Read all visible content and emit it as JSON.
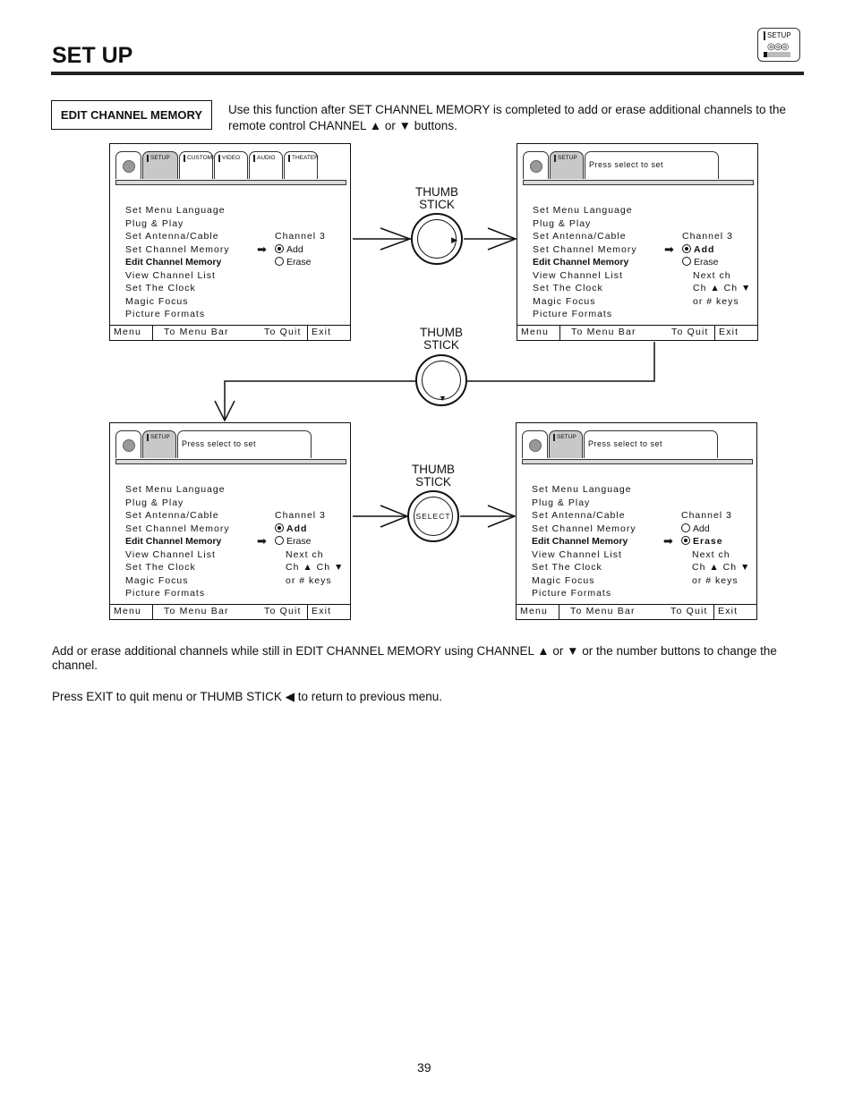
{
  "page": {
    "title": "SET UP",
    "corner_icon_label": "SETUP",
    "page_number": "39"
  },
  "section": {
    "label": "EDIT CHANNEL MEMORY",
    "intro": "Use this function after SET CHANNEL MEMORY is completed to add or erase additional channels to the remote control CHANNEL ▲ or ▼ buttons."
  },
  "menu_tabs": [
    "SETUP",
    "CUSTOMIZE",
    "VIDEO",
    "AUDIO",
    "THEATER"
  ],
  "status_text": "Press select to set",
  "menu_items": [
    "Set Menu Language",
    "Plug & Play",
    "Set Antenna/Cable",
    "Set Channel Memory",
    "Edit Channel Memory",
    "View Channel List",
    "Set The Clock",
    "Magic Focus",
    "Picture Formats"
  ],
  "footer": {
    "menu": "Menu",
    "to_menu_bar": "To Menu Bar",
    "to_quit": "To Quit",
    "exit": "Exit"
  },
  "options": {
    "channel": "Channel 3",
    "add": "Add",
    "erase": "Erase",
    "next_ch": "Next ch",
    "ch_keys": "Ch ▲ Ch ▼",
    "num_keys": "or # keys"
  },
  "screens": [
    {
      "id": 1,
      "add_selected": true,
      "erase_selected": false,
      "pointer_on": "add",
      "bold_option": "none",
      "show_hints": false
    },
    {
      "id": 2,
      "add_selected": true,
      "erase_selected": false,
      "pointer_on": "add",
      "bold_option": "add",
      "show_hints": true
    },
    {
      "id": 3,
      "add_selected": true,
      "erase_selected": false,
      "pointer_on": "erase",
      "bold_option": "add",
      "show_hints": true
    },
    {
      "id": 4,
      "add_selected": false,
      "erase_selected": true,
      "pointer_on": "erase",
      "bold_option": "erase",
      "show_hints": true
    }
  ],
  "thumb_stick": {
    "label_line1": "THUMB",
    "label_line2": "STICK",
    "select_label": "SELECT"
  },
  "body_text": {
    "para1": "Add or erase additional channels while still in EDIT CHANNEL MEMORY using CHANNEL ▲ or ▼ or the number buttons to change the channel.",
    "para2": "Press EXIT to quit menu or THUMB STICK ◀ to return to previous menu."
  }
}
